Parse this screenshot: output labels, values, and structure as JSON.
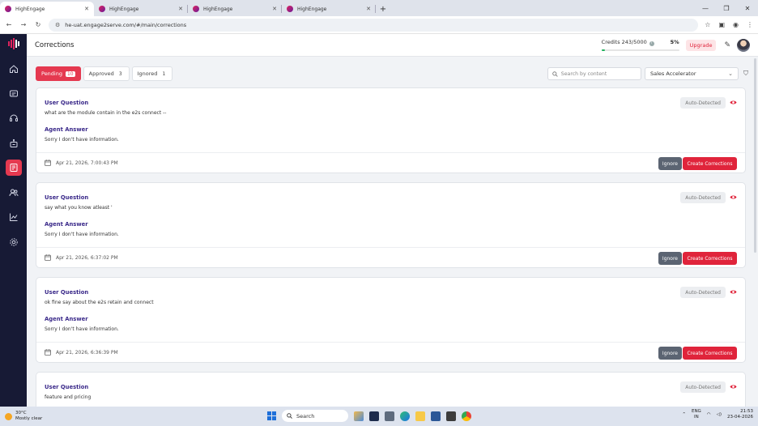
{
  "browser": {
    "tabs": [
      {
        "title": "HighEngage",
        "active": true
      },
      {
        "title": "HighEngage",
        "active": false
      },
      {
        "title": "HighEngage",
        "active": false
      },
      {
        "title": "HighEngage",
        "active": false
      }
    ],
    "url": "he-uat.engage2serve.com/#/main/corrections"
  },
  "header": {
    "title": "Corrections",
    "credits_label": "Credits 243/5000",
    "credits_percent": "5%",
    "credits_fraction": 0.05,
    "upgrade_label": "Upgrade"
  },
  "filters": {
    "tabs": [
      {
        "label": "Pending",
        "count": "10",
        "active": true
      },
      {
        "label": "Approved",
        "count": "3",
        "active": false
      },
      {
        "label": "Ignored",
        "count": "1",
        "active": false
      }
    ],
    "search_placeholder": "Search by content",
    "agent_select": "Sales Accelerator"
  },
  "cards": [
    {
      "question_label": "User Question",
      "question": "what are the module contain in the e2s connect --",
      "answer_label": "Agent Answer",
      "answer": "Sorry I don't have information.",
      "badge": "Auto-Detected",
      "date": "Apr 21, 2026, 7:00:43 PM",
      "ignore_label": "Ignore",
      "create_label": "Create Corrections"
    },
    {
      "question_label": "User Question",
      "question": "say what you know atleast '",
      "answer_label": "Agent Answer",
      "answer": "Sorry I don't have information.",
      "badge": "Auto-Detected",
      "date": "Apr 21, 2026, 6:37:02 PM",
      "ignore_label": "Ignore",
      "create_label": "Create Corrections"
    },
    {
      "question_label": "User Question",
      "question": "ok fine say about the e2s retain and connect",
      "answer_label": "Agent Answer",
      "answer": "Sorry I don't have information.",
      "badge": "Auto-Detected",
      "date": "Apr 21, 2026, 6:36:39 PM",
      "ignore_label": "Ignore",
      "create_label": "Create Corrections"
    },
    {
      "question_label": "User Question",
      "question": "feature and pricing",
      "badge": "Auto-Detected"
    }
  ],
  "taskbar": {
    "temperature": "30°C",
    "weather": "Mostly clear",
    "search_label": "Search",
    "lang_top": "ENG",
    "lang_bottom": "IN",
    "time": "21:53",
    "date": "23-04-2026"
  },
  "colors": {
    "accent": "#e0243b",
    "sidebar": "#171a35",
    "label": "#3b2a8a"
  }
}
